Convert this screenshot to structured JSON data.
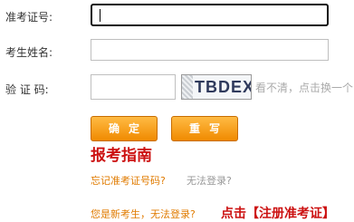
{
  "form": {
    "ticket_label": "准考证号:",
    "name_label": "考生姓名:",
    "captcha_label": "验 证 码:",
    "ticket_value": "",
    "name_value": "",
    "captcha_value": "",
    "captcha_image_text": "TBDEX",
    "captcha_hint": "看不清，点击换一个"
  },
  "buttons": {
    "confirm": "确定",
    "reset": "重写"
  },
  "guide_title": "报考指南",
  "links": {
    "forgot_ticket": "忘记准考证号码?",
    "cannot_login": "无法登录?",
    "new_examinee": "您是新考生，无法登录?",
    "register": "点击【注册准考证】"
  },
  "colors": {
    "accent_orange": "#f08a00",
    "link_orange": "#e07b00",
    "title_red": "#cc1111"
  }
}
